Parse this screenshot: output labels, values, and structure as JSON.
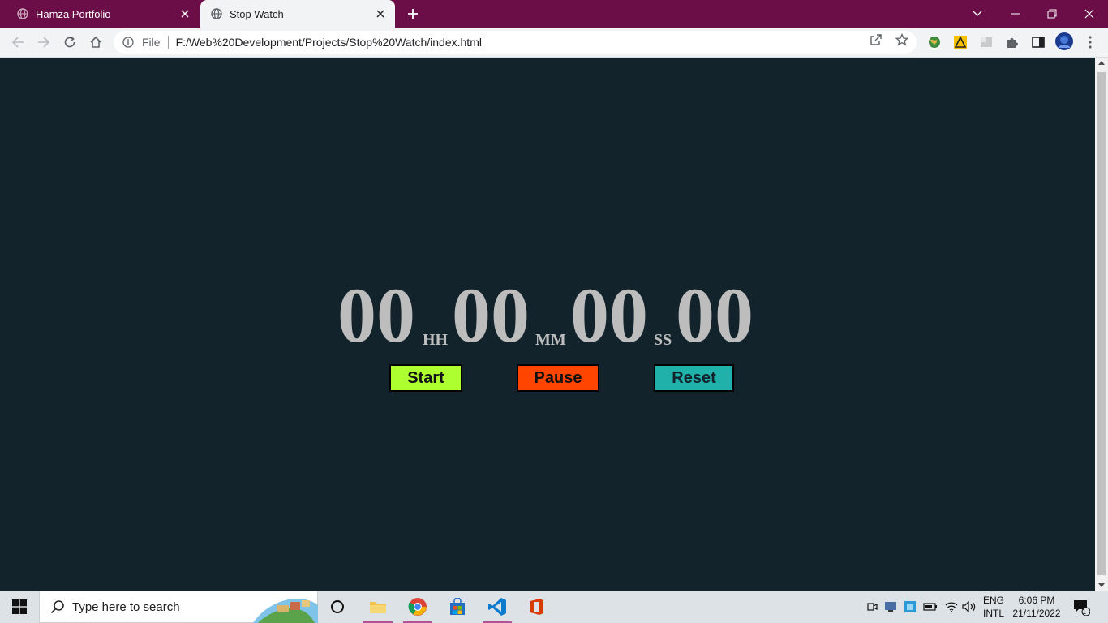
{
  "browser": {
    "tabs": [
      {
        "title": "Hamza Portfolio",
        "active": false
      },
      {
        "title": "Stop Watch",
        "active": true
      }
    ],
    "address": {
      "scheme_label": "File",
      "url": "F:/Web%20Development/Projects/Stop%20Watch/index.html"
    }
  },
  "stopwatch": {
    "hours": "00",
    "hours_unit": "HH",
    "minutes": "00",
    "minutes_unit": "MM",
    "seconds": "00",
    "seconds_unit": "SS",
    "centiseconds": "00",
    "buttons": {
      "start": "Start",
      "pause": "Pause",
      "reset": "Reset"
    }
  },
  "taskbar": {
    "search_placeholder": "Type here to search",
    "language": "ENG",
    "layout": "INTL",
    "time": "6:06 PM",
    "date": "21/11/2022",
    "notification_count": "1"
  },
  "colors": {
    "tabstrip": "#6b0d46",
    "page_bg": "#13232b",
    "start_button": "#adff2f",
    "pause_button": "#ff4500",
    "reset_button": "#20b2aa",
    "digits": "#bdbdbd"
  }
}
